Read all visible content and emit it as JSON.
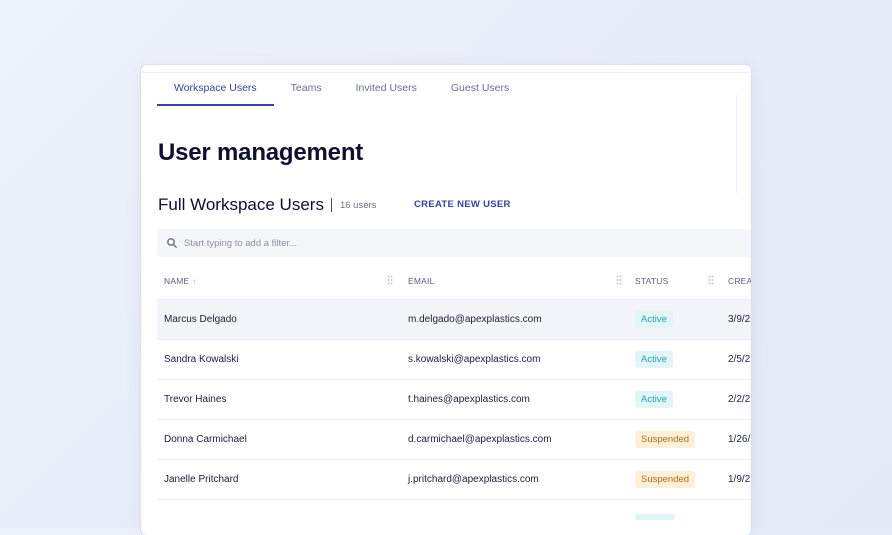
{
  "tabs": [
    {
      "label": "Workspace Users",
      "active": true
    },
    {
      "label": "Teams",
      "active": false
    },
    {
      "label": "Invited Users",
      "active": false
    },
    {
      "label": "Guest Users",
      "active": false
    }
  ],
  "page_title": "User management",
  "section": {
    "title": "Full Workspace Users",
    "count": "16 users",
    "create_button": "CREATE NEW USER"
  },
  "filter": {
    "placeholder": "Start typing to add a filter...",
    "icon": "search-icon"
  },
  "table": {
    "columns": [
      {
        "label": "NAME",
        "sort": "ascending"
      },
      {
        "label": "EMAIL"
      },
      {
        "label": "STATUS"
      },
      {
        "label": "CREA"
      }
    ],
    "rows": [
      {
        "name": "Marcus Delgado",
        "email": "m.delgado@apexplastics.com",
        "status": "Active",
        "created": "3/9/2"
      },
      {
        "name": "Sandra Kowalski",
        "email": "s.kowalski@apexplastics.com",
        "status": "Active",
        "created": "2/5/2"
      },
      {
        "name": "Trevor Haines",
        "email": "t.haines@apexplastics.com",
        "status": "Active",
        "created": "2/2/2"
      },
      {
        "name": "Donna Carmichael",
        "email": "d.carmichael@apexplastics.com",
        "status": "Suspended",
        "created": "1/26/"
      },
      {
        "name": "Janelle Pritchard",
        "email": "j.pritchard@apexplastics.com",
        "status": "Suspended",
        "created": "1/9/2"
      }
    ]
  },
  "colors": {
    "accent": "#3c3fa6",
    "active_bg": "#e3f6f7",
    "active_text": "#2aa3b0",
    "suspended_bg": "#fdf0d8",
    "suspended_text": "#b36a12"
  }
}
